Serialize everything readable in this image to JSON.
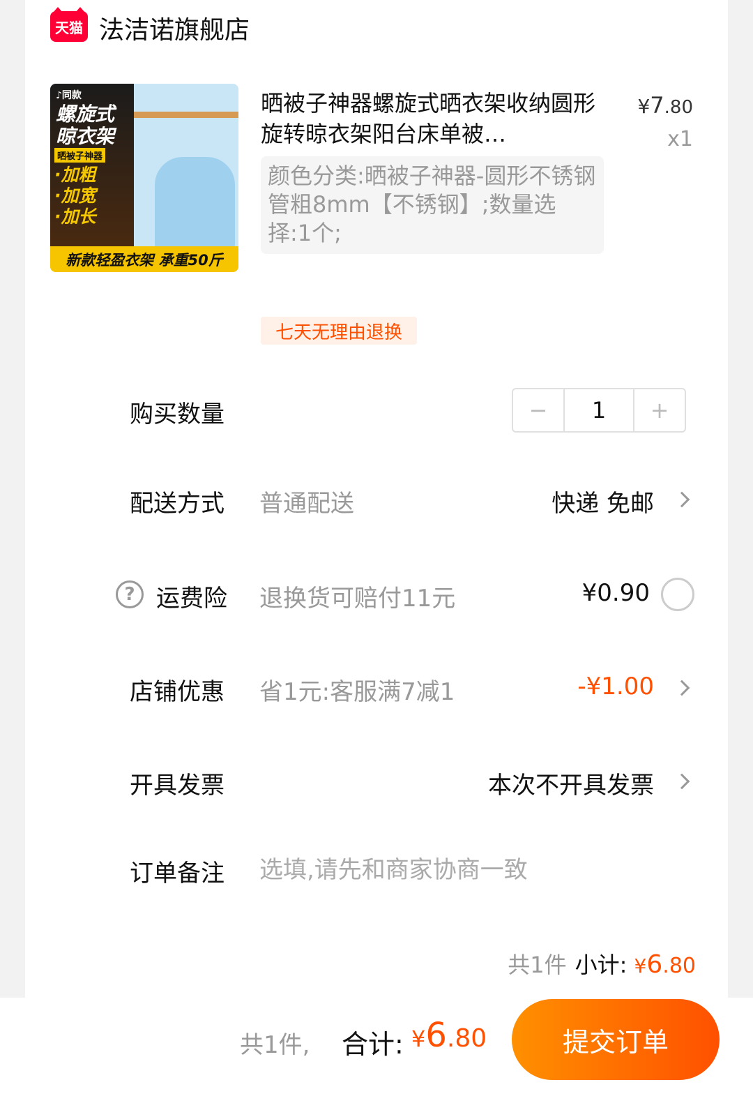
{
  "shop": {
    "logo_text": "天猫",
    "name": "法洁诺旗舰店"
  },
  "product": {
    "image_tag": "♪同款",
    "image_headline": "螺旋式\n晾衣架",
    "image_sub": "晒被子神器",
    "image_bullets": "·加粗\n·加宽\n·加长",
    "image_bottom": "新款轻盈衣架 承重50斤",
    "title": "晒被子神器螺旋式晒衣架收纳圆形旋转晾衣架阳台床单被…",
    "price_symbol": "¥",
    "price_int": "7",
    "price_dec": ".80",
    "quantity_text": "x1",
    "sku": "颜色分类:晒被子神器-圆形不锈钢管粗8mm【不锈钢】;数量选择:1个;",
    "return_tag": "七天无理由退换"
  },
  "quantity": {
    "label": "购买数量",
    "minus": "−",
    "value": "1",
    "plus": "+"
  },
  "delivery": {
    "label": "配送方式",
    "desc": "普通配送",
    "value": "快递 免邮"
  },
  "insurance": {
    "help_icon": "?",
    "label": "运费险",
    "desc": "退换货可赔付11元",
    "value": "¥0.90"
  },
  "store_discount": {
    "label": "店铺优惠",
    "desc": "省1元:客服满7减1",
    "value": "-¥1.00"
  },
  "invoice": {
    "label": "开具发票",
    "value": "本次不开具发票"
  },
  "remark": {
    "label": "订单备注",
    "placeholder": "选填,请先和商家协商一致"
  },
  "subtotal": {
    "count": "共1件",
    "label": "小计:",
    "symbol": "¥",
    "int": "6",
    "dec": ".80"
  },
  "bottom_bar": {
    "count": "共1件,",
    "total_label": "合计:",
    "symbol": "¥",
    "int": "6",
    "dec": ".80",
    "submit": "提交订单"
  },
  "colors": {
    "accent": "#ff5000",
    "tmall_red": "#ff0036",
    "muted_text": "#999999"
  }
}
